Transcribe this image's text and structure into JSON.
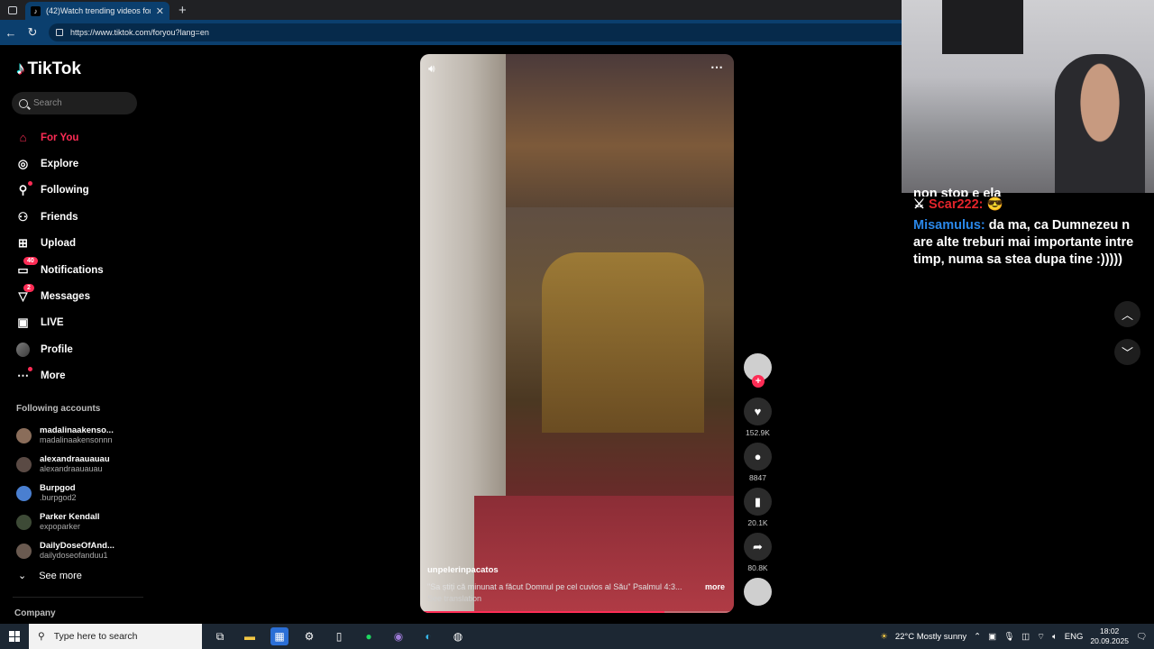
{
  "browser": {
    "tab_title": "(42)Watch trending videos for yo",
    "tab_icon": "tiktok-favicon",
    "url": "https://www.tiktok.com/foryou?lang=en"
  },
  "sidebar": {
    "logo": "TikTok",
    "search_placeholder": "Search",
    "nav": [
      {
        "label": "For You",
        "icon": "home-icon",
        "active": true
      },
      {
        "label": "Explore",
        "icon": "compass-icon"
      },
      {
        "label": "Following",
        "icon": "following-icon"
      },
      {
        "label": "Friends",
        "icon": "friends-icon"
      },
      {
        "label": "Upload",
        "icon": "upload-icon"
      },
      {
        "label": "Notifications",
        "icon": "inbox-icon",
        "badge": "40"
      },
      {
        "label": "Messages",
        "icon": "messages-icon",
        "badge": "2"
      },
      {
        "label": "LIVE",
        "icon": "live-icon"
      },
      {
        "label": "Profile",
        "icon": "avatar"
      },
      {
        "label": "More",
        "icon": "more-icon"
      }
    ],
    "following_title": "Following accounts",
    "accounts": [
      {
        "name": "madalinaakenso...",
        "handle": "madalinaakensonnn"
      },
      {
        "name": "alexandraauauau",
        "handle": "alexandraauauau"
      },
      {
        "name": "Burpgod",
        "handle": ".burpgod2"
      },
      {
        "name": "Parker Kendall",
        "handle": "expoparker"
      },
      {
        "name": "DailyDoseOfAnd...",
        "handle": "dailydoseofanduu1"
      }
    ],
    "see_more": "See more",
    "company": "Company"
  },
  "video": {
    "username": "unpelerinpacatos",
    "caption": "\"Sa știți că minunat a făcut Domnul pe cel cuvios al Său\" Psalmul 4:3...",
    "more": "more",
    "see_translation": "See translation",
    "progress_fraction": 0.78
  },
  "actions": {
    "likes": "152.9K",
    "comments": "8847",
    "saves": "20.1K",
    "shares": "80.8K"
  },
  "stream_chat": {
    "cut_line": "non stop e ela",
    "msg1_user": "Scar222:",
    "msg1_text": "😎",
    "msg2_user": "Misamulus:",
    "msg2_text": "da ma, ca Dumnezeu n are alte treburi mai importante intre timp, numa sa stea dupa tine :)))))"
  },
  "taskbar": {
    "search_placeholder": "Type here to search",
    "weather": "22°C  Mostly sunny",
    "language": "ENG",
    "time": "18:02",
    "date": "20.09.2025"
  },
  "colors": {
    "accent": "#fe2c55",
    "chat_red": "#e3242b",
    "chat_blue": "#2a87e8"
  }
}
